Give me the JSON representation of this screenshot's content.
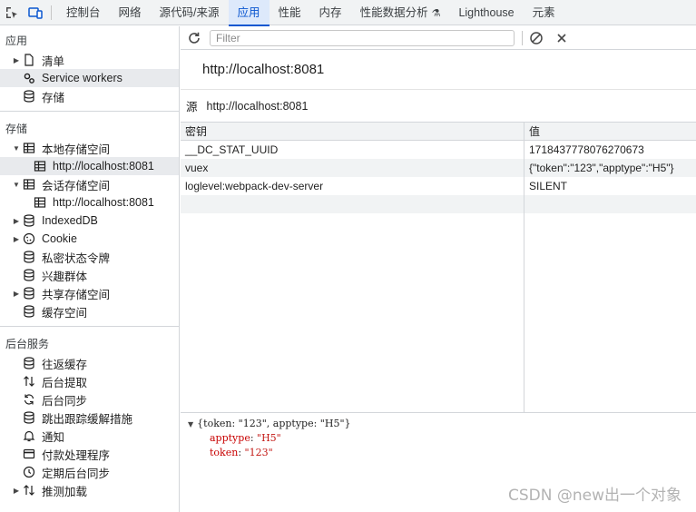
{
  "tabs": {
    "elements": "控制台",
    "network": "网络",
    "sources": "源代码/来源",
    "application": "应用",
    "performance": "性能",
    "memory": "内存",
    "perf_insights": "性能数据分析",
    "lighthouse": "Lighthouse",
    "elements_tab": "元素"
  },
  "sidebar": {
    "app_section": "应用",
    "app_items": [
      {
        "label": "清单"
      },
      {
        "label": "Service workers"
      },
      {
        "label": "存储"
      }
    ],
    "storage_section": "存储",
    "local_storage": "本地存储空间",
    "local_storage_origin": "http://localhost:8081",
    "session_storage": "会话存储空间",
    "session_storage_origin": "http://localhost:8081",
    "indexeddb": "IndexedDB",
    "cookie": "Cookie",
    "private_tokens": "私密状态令牌",
    "interest_groups": "兴趣群体",
    "shared_storage": "共享存储空间",
    "cache_storage": "缓存空间",
    "bg_section": "后台服务",
    "bg_items": [
      {
        "label": "往返缓存",
        "icon": "back-forward-cache-icon"
      },
      {
        "label": "后台提取",
        "icon": "background-fetch-icon"
      },
      {
        "label": "后台同步",
        "icon": "background-sync-icon"
      },
      {
        "label": "跳出跟踪缓解措施",
        "icon": "bounce-tracking-icon"
      },
      {
        "label": "通知",
        "icon": "bell-icon"
      },
      {
        "label": "付款处理程序",
        "icon": "payment-handler-icon"
      },
      {
        "label": "定期后台同步",
        "icon": "clock-icon"
      },
      {
        "label": "推测加载",
        "icon": "speculative-loads-icon"
      }
    ]
  },
  "toolbar": {
    "filter_placeholder": "Filter"
  },
  "origin_title": "http://localhost:8081",
  "origin_label": "源",
  "origin_value": "http://localhost:8081",
  "table": {
    "key_header": "密钥",
    "value_header": "值",
    "rows": [
      {
        "key": "__DC_STAT_UUID",
        "value": "17184377780762706​73"
      },
      {
        "key": "vuex",
        "value": "{\"token\":\"123\",\"apptype\":\"H5\"}"
      },
      {
        "key": "loglevel:webpack-dev-server",
        "value": "SILENT"
      }
    ]
  },
  "preview": {
    "summary": "{token: \"123\", apptype: \"H5\"}",
    "line1_key": "apptype",
    "line1_val": "\"H5\"",
    "line2_key": "token",
    "line2_val": "\"123\""
  },
  "watermark": "CSDN @new出一个对象",
  "colors": {
    "accent": "#0b57d0",
    "active_tab_bg": "#dde9fb",
    "row_alt": "#f1f3f4"
  }
}
